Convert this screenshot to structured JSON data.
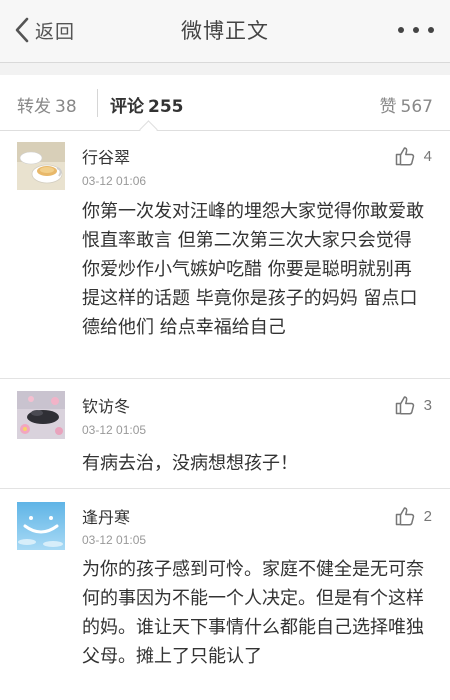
{
  "navbar": {
    "back_label": "返回",
    "title": "微博正文",
    "more_icon": "more-dots-icon"
  },
  "tabs": {
    "repost_label": "转发",
    "repost_count": "38",
    "comments_label": "评论",
    "comments_count": "255",
    "likes_label": "赞",
    "likes_count": "567"
  },
  "comments": [
    {
      "name": "行谷翠",
      "time": "03-12 01:06",
      "likes": "4",
      "text": "你第一次发对汪峰的埋怨大家觉得你敢爱敢恨直率敢言 但第二次第三次大家只会觉得你爱炒作小气嫉妒吃醋 你要是聪明就别再提这样的话题 毕竟你是孩子的妈妈 留点口德给他们 给点幸福给自己"
    },
    {
      "name": "钦访冬",
      "time": "03-12 01:05",
      "likes": "3",
      "text": "有病去治，没病想想孩子！"
    },
    {
      "name": "逢丹寒",
      "time": "03-12 01:05",
      "likes": "2",
      "text": "为你的孩子感到可怜。家庭不健全是无可奈何的事因为不能一个人决定。但是有个这样的妈。谁让天下事情什么都能自己选择唯独父母。摊上了只能认了"
    }
  ],
  "colors": {
    "navbar_bg": "#f7f7f7",
    "gap_bg": "#f2f2f2",
    "text": "#333333",
    "muted": "#999999"
  }
}
